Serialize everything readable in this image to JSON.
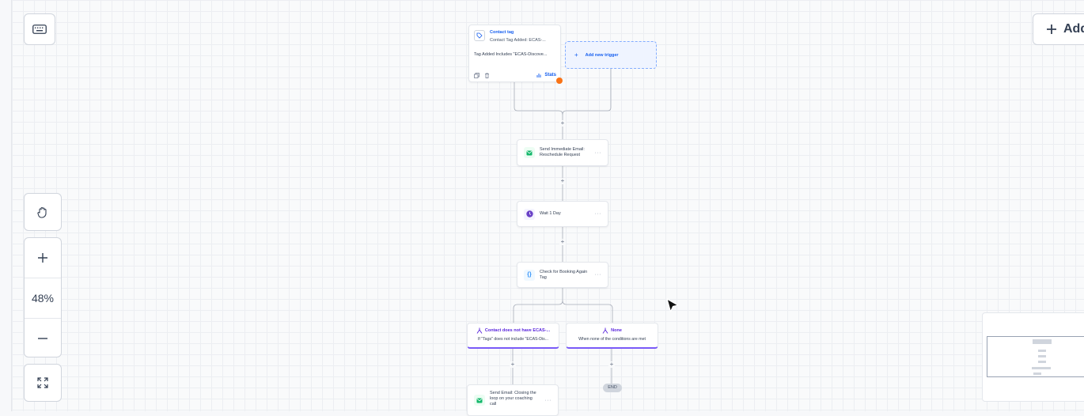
{
  "toolbar": {
    "keyboard_icon": "keyboard-icon",
    "hand_icon": "hand-icon",
    "zoom_in_icon": "plus-icon",
    "zoom_level": "48%",
    "zoom_out_icon": "minus-icon",
    "fit_icon": "expand-icon"
  },
  "add_button": {
    "label": "Add",
    "icon": "plus-icon"
  },
  "trigger": {
    "title": "Contact tag",
    "subtitle": "Contact Tag Added: ECAS-...",
    "description": "Tag Added Includes \"ECAS-Discove...",
    "stats_label": "Stats",
    "warning_color": "#f97316"
  },
  "add_trigger": {
    "label": "Add new trigger"
  },
  "steps": [
    {
      "line1": "Send Immediate Email:",
      "line2": "Reschedule Request",
      "icon": "email-icon",
      "icon_color": "#12b76a"
    },
    {
      "line1": "Wait 1 Day",
      "line2": "",
      "icon": "clock-icon",
      "icon_color": "#6941c6"
    },
    {
      "line1": "Check for Booking Again",
      "line2": "Tag",
      "icon": "code-braces-icon",
      "icon_color": "#2e90fa"
    }
  ],
  "branches": [
    {
      "title": "Contact does not have ECAS-...",
      "description": "If \"Tags\" does not include \"ECAS-Dis..."
    },
    {
      "title": "None",
      "description": "When none of the conditions are met"
    }
  ],
  "final_step": {
    "line1": "Send Email: Closing the",
    "line2": "loop on your coaching",
    "line3": "call"
  },
  "end_label": "END",
  "colors": {
    "accent": "#155eef",
    "branch": "#7a5af8",
    "email": "#12b76a",
    "canvas": "#f9fafb"
  }
}
